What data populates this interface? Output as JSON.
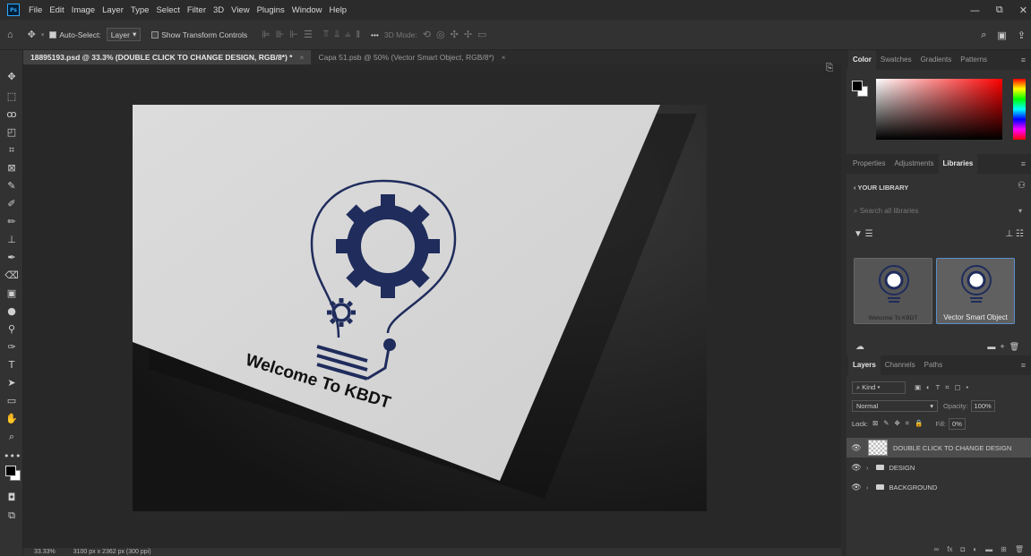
{
  "app": {
    "logo_text": "Ps",
    "menu": [
      "File",
      "Edit",
      "Image",
      "Layer",
      "Type",
      "Select",
      "Filter",
      "3D",
      "View",
      "Plugins",
      "Window",
      "Help"
    ],
    "window_controls": [
      "—",
      "⧉",
      "✕"
    ]
  },
  "options_bar": {
    "auto_select_label": "Auto-Select:",
    "auto_select_value": "Layer",
    "show_transform_label": "Show Transform Controls",
    "more": "•••",
    "mode_3d_label": "3D Mode:"
  },
  "tabs": [
    {
      "label": "18895193.psd @ 33.3% (DOUBLE CLICK TO CHANGE DESIGN, RGB/8*) *",
      "close": "×"
    },
    {
      "label": "Capa 51.psb @ 50% (Vector Smart Object, RGB/8*)",
      "close": "×"
    }
  ],
  "canvas": {
    "logo_text": "Welcome To KBDT"
  },
  "status": {
    "zoom": "33.33%",
    "doc_size": "3100 px x 2362 px (300 ppi)"
  },
  "color_panel": {
    "tabs": [
      "Color",
      "Swatches",
      "Gradients",
      "Patterns"
    ],
    "active": "Color"
  },
  "libraries_panel": {
    "tabs": [
      "Properties",
      "Adjustments",
      "Libraries"
    ],
    "active": "Libraries",
    "your_library": "YOUR LIBRARY",
    "search_placeholder": "Search all libraries",
    "items": [
      {
        "caption": "Welcome To KBDT"
      },
      {
        "caption": "Vector Smart Object"
      }
    ]
  },
  "layers_panel": {
    "tabs": [
      "Layers",
      "Channels",
      "Paths"
    ],
    "active": "Layers",
    "kind_label": "Kind",
    "blend_mode": "Normal",
    "opacity_label": "Opacity:",
    "opacity_value": "100%",
    "lock_label": "Lock:",
    "fill_label": "Fill:",
    "fill_value": "0%",
    "layers": [
      {
        "name": "DOUBLE CLICK TO CHANGE DESIGN",
        "type": "smart-object",
        "selected": true
      },
      {
        "name": "DESIGN",
        "type": "group",
        "selected": false
      },
      {
        "name": "BACKGROUND",
        "type": "group",
        "selected": false
      }
    ]
  },
  "colors": {
    "ui_dark": "#2b2b2b",
    "ui_panel": "#323232",
    "logo_navy": "#1f2c5c",
    "accent_blue": "#31a8ff"
  }
}
